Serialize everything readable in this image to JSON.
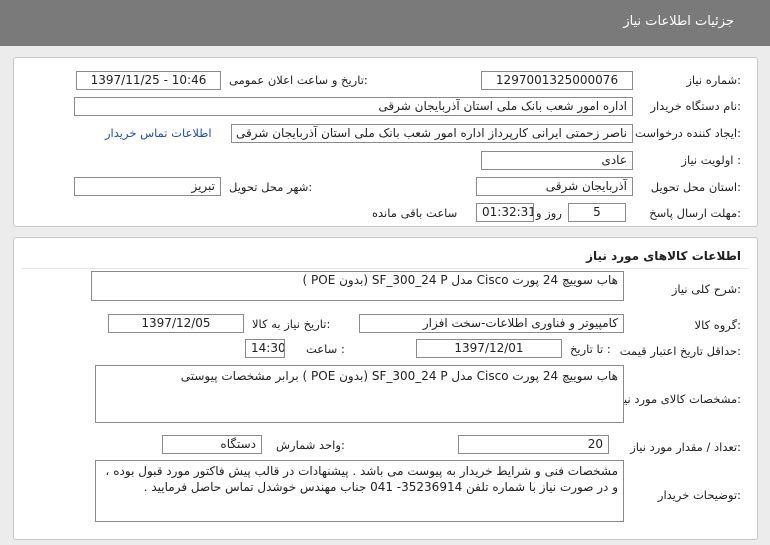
{
  "header": {
    "title": "جزئیات اطلاعات نیاز"
  },
  "need_info": {
    "need_number_label": "شماره نیاز:",
    "need_number": "1297001325000076",
    "announce_label": "تاریخ و ساعت اعلان عمومی:",
    "announce_value": "1397/11/25 - 10:46",
    "buyer_label": "نام دستگاه خریدار:",
    "buyer_value": "اداره امور شعب بانک ملی استان آذربایجان شرقی",
    "creator_label": "ایجاد کننده درخواست:",
    "creator_value": "ناصر  زحمتی ایرانی کارپرداز اداره امور شعب بانک ملی استان آذربایجان شرقی",
    "contact_link": "اطلاعات تماس خریدار",
    "priority_label": "اولویت نیاز :",
    "priority_value": "عادی",
    "province_label": "استان محل تحویل:",
    "province_value": "آذربایجان شرقی",
    "city_label": "شهر محل تحویل:",
    "city_value": "تبریز",
    "deadline_label": "مهلت ارسال پاسخ:",
    "days_value": "5",
    "days_unit": "روز و",
    "time_value": "01:32:31",
    "time_unit": "ساعت باقی مانده"
  },
  "goods": {
    "section_title": "اطلاعات کالاهای مورد نیاز",
    "general_label": "شرح کلی نیاز:",
    "general_value": "هاب سوییچ 24 پورت Cisco مدل SF_300_24 P (بدون POE )",
    "group_label": "گروه کالا:",
    "group_value": "کامپیوتر و فناوری اطلاعات-سخت افزار",
    "need_date_label": "تاریخ نیاز به کالا:",
    "need_date_value": "1397/12/05",
    "min_validity_label": "حداقل تاریخ اعتبار قیمت:",
    "to_date_label": "تا تاریخ :",
    "to_date_value": "1397/12/01",
    "hour_label": "ساعت :",
    "hour_value": "14:30",
    "spec_label": "مشخصات کالای مورد نیاز:",
    "spec_value": "هاب سوییچ 24 پورت Cisco مدل SF_300_24 P (بدون POE ) برابر مشخصات پیوستی",
    "qty_label": "تعداد / مقدار مورد نیاز:",
    "qty_value": "20",
    "unit_label": "واحد شمارش:",
    "unit_value": "دستگاه",
    "buyer_notes_label": "توضیحات خریدار:",
    "buyer_notes_value": "مشخصات فنی و شرایط خریدار به پیوست می باشد . پیشنهادات در قالب پیش فاکتور مورد قبول بوده ، و در صورت نیاز با شماره تلفن 35236914- 041 جناب مهندس خوشدل تماس حاصل فرمایید ."
  }
}
